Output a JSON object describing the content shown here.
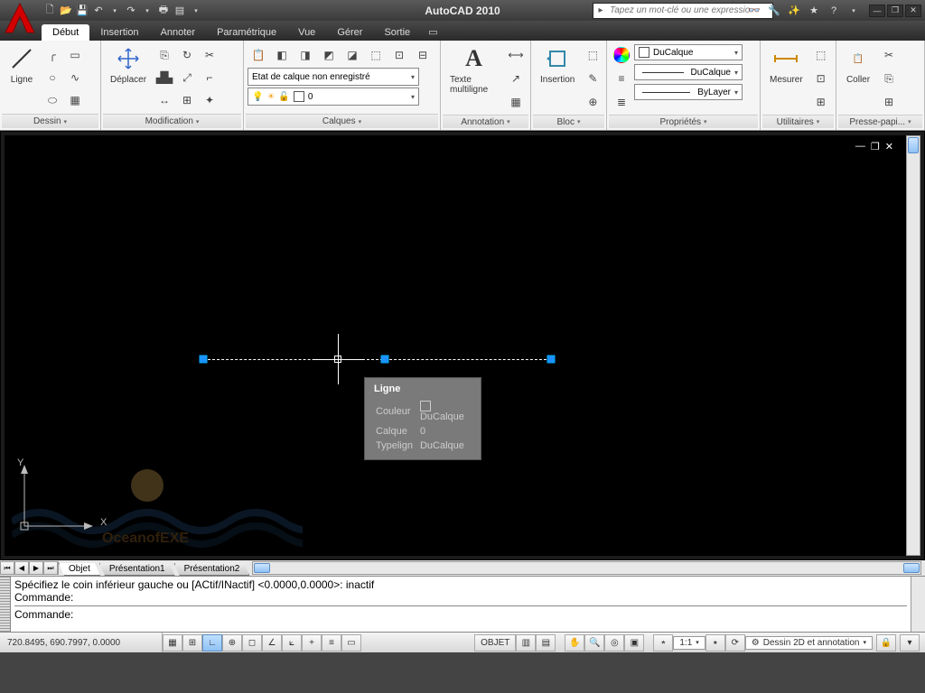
{
  "app": {
    "title": "AutoCAD 2010"
  },
  "search": {
    "placeholder": "Tapez un mot-clé ou une expressio"
  },
  "tabs": [
    "Début",
    "Insertion",
    "Annoter",
    "Paramétrique",
    "Vue",
    "Gérer",
    "Sortie"
  ],
  "ribbon": {
    "dessin": {
      "label": "Dessin",
      "big": "Ligne"
    },
    "modif": {
      "label": "Modification",
      "big": "Déplacer"
    },
    "calques": {
      "label": "Calques",
      "state": "Etat de calque non enregistré",
      "layer": "0"
    },
    "annot": {
      "label": "Annotation",
      "big": "Texte multiligne"
    },
    "bloc": {
      "label": "Bloc",
      "big": "Insertion"
    },
    "props": {
      "label": "Propriétés",
      "color": "DuCalque",
      "ltype": "DuCalque",
      "lweight": "ByLayer"
    },
    "util": {
      "label": "Utilitaires",
      "big": "Mesurer"
    },
    "clip": {
      "label": "Presse-papi...",
      "big": "Coller"
    }
  },
  "tooltip": {
    "title": "Ligne",
    "rows": [
      {
        "k": "Couleur",
        "v": "DuCalque"
      },
      {
        "k": "Calque",
        "v": "0"
      },
      {
        "k": "Typelign",
        "v": "DuCalque"
      }
    ]
  },
  "ucs": {
    "x": "X",
    "y": "Y"
  },
  "sheets": {
    "active": "Objet",
    "p1": "Présentation1",
    "p2": "Présentation2"
  },
  "cmd": {
    "line1": "Spécifiez le coin inférieur gauche ou [ACtif/INactif] <0.0000,0.0000>: inactif",
    "line2": "Commande:",
    "line3": "Commande:"
  },
  "status": {
    "coords": "720.8495, 690.7997, 0.0000",
    "objet": "OBJET",
    "scale": "1:1",
    "workspace": "Dessin 2D et annotation",
    "watermark": "OceanofEXE"
  }
}
